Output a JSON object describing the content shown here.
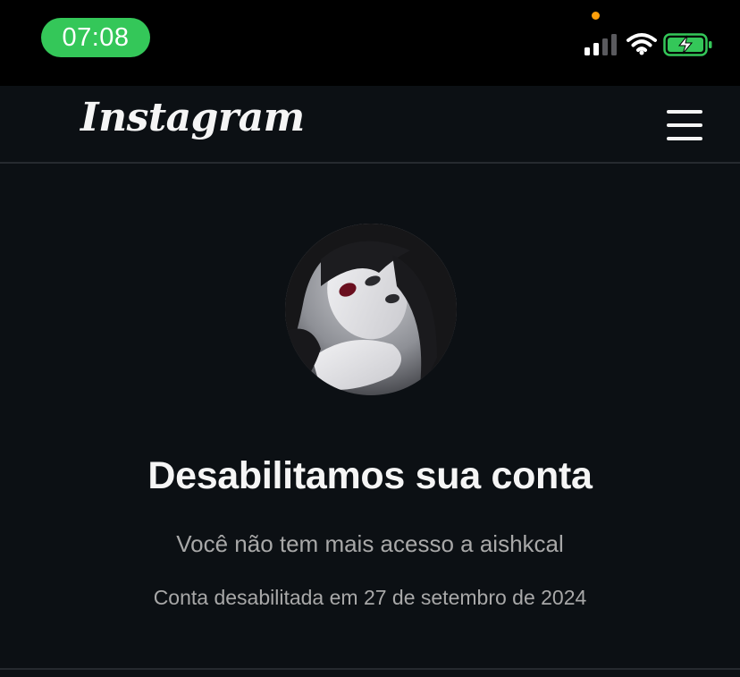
{
  "status_bar": {
    "time": "07:08",
    "signal_icon": "cellular-signal-icon",
    "wifi_icon": "wifi-icon",
    "battery_icon": "battery-charging-icon",
    "time_pill_color": "#34c759",
    "privacy_dot_color": "#ff9f0a",
    "battery_color": "#34c759"
  },
  "header": {
    "logo_text": "Instagram",
    "menu_icon": "hamburger-menu-icon"
  },
  "main": {
    "heading": "Desabilitamos sua conta",
    "subtitle": "Você não tem mais acesso a aishkcal",
    "disabled_date": "Conta desabilitada em 27 de setembro de 2024"
  },
  "colors": {
    "background": "#0c1014",
    "text_primary": "#f5f5f5",
    "text_secondary": "#a8a8a8",
    "divider": "#262a2f"
  }
}
